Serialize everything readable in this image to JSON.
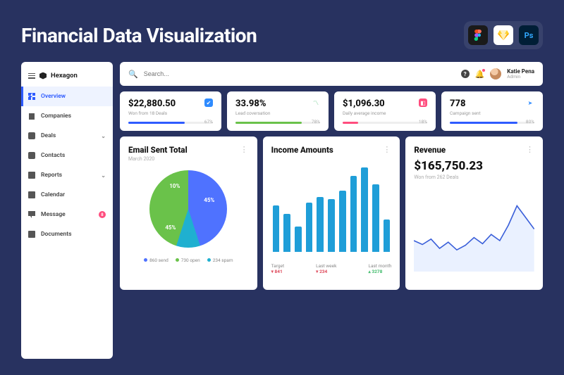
{
  "hero": {
    "title": "Financial Data Visualization"
  },
  "app_icons": [
    {
      "name": "figma"
    },
    {
      "name": "sketch"
    },
    {
      "name": "photoshop",
      "label": "Ps"
    }
  ],
  "brand": {
    "name": "Hexagon"
  },
  "sidebar": {
    "items": [
      {
        "label": "Overview",
        "icon": "grid",
        "active": true
      },
      {
        "label": "Companies",
        "icon": "building"
      },
      {
        "label": "Deals",
        "icon": "bag",
        "expandable": true
      },
      {
        "label": "Contacts",
        "icon": "user"
      },
      {
        "label": "Reports",
        "icon": "doc",
        "expandable": true
      },
      {
        "label": "Calendar",
        "icon": "cal"
      },
      {
        "label": "Message",
        "icon": "msg",
        "badge": "8"
      },
      {
        "label": "Documents",
        "icon": "doc"
      }
    ]
  },
  "search": {
    "placeholder": "Search..."
  },
  "user": {
    "name": "Katie Pena",
    "role": "Admin"
  },
  "kpis": [
    {
      "value": "$22,880.50",
      "sub": "Won from 18 Deals",
      "pct": "67%",
      "pct_num": 67,
      "bar_color": "#2e5bff",
      "icon_bg": "#2e8bff",
      "icon_glyph": "✔"
    },
    {
      "value": "33.98%",
      "sub": "Lead coversation",
      "pct": "78%",
      "pct_num": 78,
      "bar_color": "#6ac24a",
      "icon_bg": "transparent",
      "icon_glyph": "〽",
      "icon_color": "#4bbf73"
    },
    {
      "value": "$1,096.30",
      "sub": "Daily average income",
      "pct": "18%",
      "pct_num": 18,
      "bar_color": "#ff4d7e",
      "icon_bg": "#ff4d7e",
      "icon_glyph": "◧"
    },
    {
      "value": "778",
      "sub": "Campaign sent",
      "pct": "80%",
      "pct_num": 80,
      "bar_color": "#2e5bff",
      "icon_bg": "transparent",
      "icon_glyph": "➤",
      "icon_color": "#2e8bff"
    }
  ],
  "email_card": {
    "title": "Email Sent Total",
    "sub": "March 2020",
    "legend": [
      {
        "label": "860 send",
        "color": "#4f72ff"
      },
      {
        "label": "730 open",
        "color": "#6ac24a"
      },
      {
        "label": "234 spam",
        "color": "#1fb0d0"
      }
    ]
  },
  "income_card": {
    "title": "Income Amounts",
    "legend": [
      {
        "label": "Target",
        "value": "841",
        "trend": "down"
      },
      {
        "label": "Last week",
        "value": "234",
        "trend": "down"
      },
      {
        "label": "Last month",
        "value": "3278",
        "trend": "up"
      }
    ]
  },
  "revenue_card": {
    "title": "Revenue",
    "value": "$165,750.23",
    "sub": "Won from 262 Deals"
  },
  "chart_data": [
    {
      "type": "pie",
      "title": "Email Sent Total",
      "series": [
        {
          "name": "send",
          "value": 45,
          "label": "45%",
          "color": "#4f72ff"
        },
        {
          "name": "open",
          "value": 45,
          "label": "45%",
          "color": "#6ac24a"
        },
        {
          "name": "spam",
          "value": 10,
          "label": "10%",
          "color": "#1fb0d0"
        }
      ]
    },
    {
      "type": "bar",
      "title": "Income Amounts",
      "categories": [
        "1",
        "2",
        "3",
        "4",
        "5",
        "6",
        "7",
        "8",
        "9",
        "10",
        "11"
      ],
      "values": [
        55,
        45,
        30,
        58,
        65,
        62,
        72,
        90,
        100,
        80,
        38
      ],
      "ylim": [
        0,
        100
      ]
    },
    {
      "type": "line",
      "title": "Revenue",
      "x": [
        0,
        1,
        2,
        3,
        4,
        5,
        6,
        7,
        8,
        9,
        10,
        11,
        12,
        13,
        14
      ],
      "values": [
        40,
        35,
        42,
        30,
        38,
        28,
        34,
        44,
        36,
        48,
        40,
        60,
        85,
        70,
        55
      ],
      "ylim": [
        0,
        100
      ]
    }
  ]
}
